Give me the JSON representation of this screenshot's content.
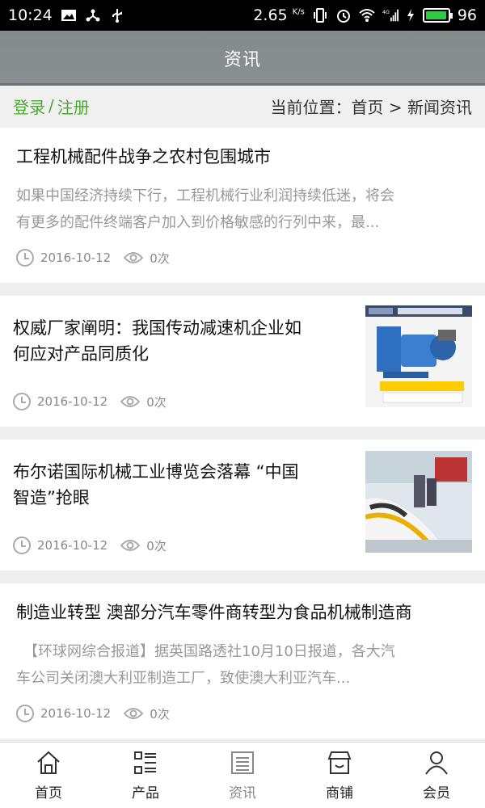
{
  "status_bar": {
    "time": "10:24",
    "net_speed": "2.65",
    "net_unit": "K/s",
    "network_type": "4G",
    "battery_level": "96",
    "left_icons": [
      "image-icon",
      "share-icon",
      "usb-icon"
    ],
    "right_icons": [
      "vibrate-icon",
      "alarm-icon",
      "wifi-icon",
      "signal-icon",
      "charging-icon",
      "battery-icon"
    ]
  },
  "header": {
    "title": "资讯"
  },
  "breadcrumb": {
    "login": "登录",
    "separator": "/",
    "register": "注册",
    "location": "当前位置：首页 > 新闻资讯"
  },
  "articles": [
    {
      "title": "工程机械配件战争之农村包围城市",
      "summary_line1": "如果中国经济持续下行，工程机械行业利润持续低迷，将会",
      "summary_line2": "有更多的配件终端客户加入到价格敏感的行列中来，最...",
      "date": "2016-10-12",
      "views": "0次",
      "has_image": false
    },
    {
      "title_line1": "权威厂家阐明：我国传动减速机企业如",
      "title_line2": "何应对产品同质化",
      "date": "2016-10-12",
      "views": "0次",
      "has_image": true,
      "image": "gear-reducer-product-photo"
    },
    {
      "title_line1": "布尔诺国际机械工业博览会落幕 “中国",
      "title_line2": "智造”抢眼",
      "date": "2016-10-12",
      "views": "0次",
      "has_image": true,
      "image": "high-speed-train-expo-photo"
    },
    {
      "title": "制造业转型 澳部分汽车零件商转型为食品机械制造商",
      "summary_line1": "　【环球网综合报道】据英国路透社10月10日报道，各大汽",
      "summary_line2": "车公司关闭澳大利亚制造工厂，致使澳大利亚汽车...",
      "date": "2016-10-12",
      "views": "0次",
      "has_image": false
    }
  ],
  "bottom_nav": [
    {
      "label": "首页",
      "icon": "home-icon",
      "active": false
    },
    {
      "label": "产品",
      "icon": "list-icon",
      "active": false
    },
    {
      "label": "资讯",
      "icon": "news-icon",
      "active": true
    },
    {
      "label": "商铺",
      "icon": "shop-icon",
      "active": false
    },
    {
      "label": "会员",
      "icon": "user-icon",
      "active": false
    }
  ],
  "colors": {
    "header_bg": "#888d8e",
    "login_link": "#4caa2e",
    "battery_fill": "#2ecc40",
    "muted_text": "#999999"
  }
}
